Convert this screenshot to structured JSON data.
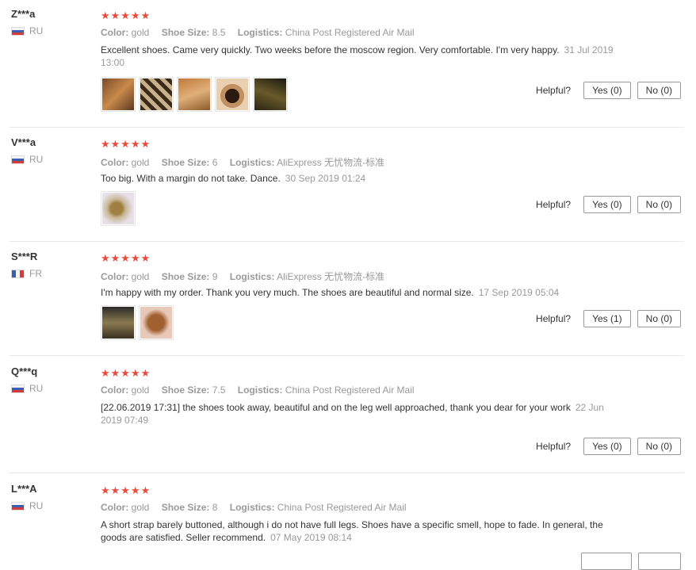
{
  "labels": {
    "color": "Color:",
    "shoe_size": "Shoe Size:",
    "logistics": "Logistics:",
    "helpful": "Helpful?"
  },
  "reviews": [
    {
      "user": "Z***a",
      "country": "RU",
      "rating": 5,
      "color": "gold",
      "shoe_size": "8.5",
      "logistics": "China Post Registered Air Mail",
      "text": "Excellent shoes. Came very quickly. Two weeks before the moscow region. Very comfortable. I'm very happy.",
      "date": "31 Jul 2019 13:00",
      "photos": 5,
      "yes": "Yes (0)",
      "no": "No (0)"
    },
    {
      "user": "V***a",
      "country": "RU",
      "rating": 5,
      "color": "gold",
      "shoe_size": "6",
      "logistics": "AliExpress 无忧物流-标准",
      "text": "Too big. With a margin do not take. Dance.",
      "date": "30 Sep 2019 01:24",
      "photos": 1,
      "yes": "Yes (0)",
      "no": "No (0)"
    },
    {
      "user": "S***R",
      "country": "FR",
      "rating": 4.8,
      "color": "gold",
      "shoe_size": "9",
      "logistics": "AliExpress 无忧物流-标准",
      "text": "I'm happy with my order. Thank you very much. The shoes are beautiful and normal size.",
      "date": "17 Sep 2019 05:04",
      "photos": 2,
      "yes": "Yes (1)",
      "no": "No (0)"
    },
    {
      "user": "Q***q",
      "country": "RU",
      "rating": 5,
      "color": "gold",
      "shoe_size": "7.5",
      "logistics": "China Post Registered Air Mail",
      "text": "[22.06.2019 17:31] the shoes took away, beautiful and on the leg well approached, thank you dear for your work",
      "date": "22 Jun 2019 07:49",
      "photos": 0,
      "yes": "Yes (0)",
      "no": "No (0)"
    },
    {
      "user": "L***A",
      "country": "RU",
      "rating": 5,
      "color": "gold",
      "shoe_size": "8",
      "logistics": "China Post Registered Air Mail",
      "text": "A short strap barely buttoned, although i do not have full legs. Shoes have a specific smell, hope to fade. In general, the goods are satisfied. Seller recommend.",
      "date": "07 May 2019 08:14",
      "photos": 0,
      "yes": "",
      "no": ""
    }
  ],
  "colors": {
    "star": "#e84c3d",
    "muted": "#999999",
    "divider": "#e8e8e8"
  }
}
